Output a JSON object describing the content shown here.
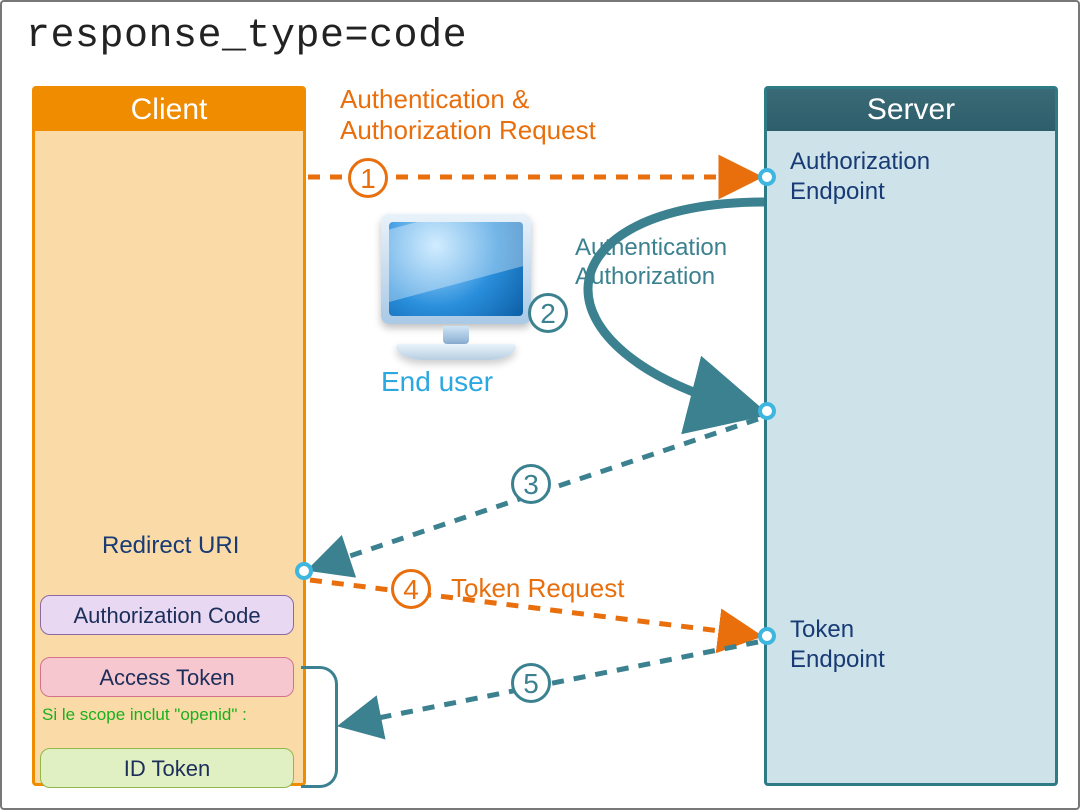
{
  "title": "response_type=code",
  "client": {
    "header": "Client",
    "redirect_label": "Redirect URI",
    "tokens": {
      "authorization_code": "Authorization Code",
      "access_token": "Access Token",
      "id_token": "ID Token"
    },
    "scope_note": "Si le scope inclut \"openid\" :"
  },
  "server": {
    "header": "Server",
    "authorization_endpoint": "Authorization\nEndpoint",
    "token_endpoint": "Token\nEndpoint"
  },
  "end_user_label": "End user",
  "steps": {
    "s1": "1",
    "s2": "2",
    "s3": "3",
    "s4": "4",
    "s5": "5"
  },
  "labels": {
    "auth_request": "Authentication &\nAuthorization Request",
    "authn_authz": "Authentication\nAuthorization",
    "token_request": "Token Request"
  },
  "colors": {
    "orange": "#E96E0C",
    "teal": "#3B8190",
    "node_blue": "#3FB6DF"
  }
}
